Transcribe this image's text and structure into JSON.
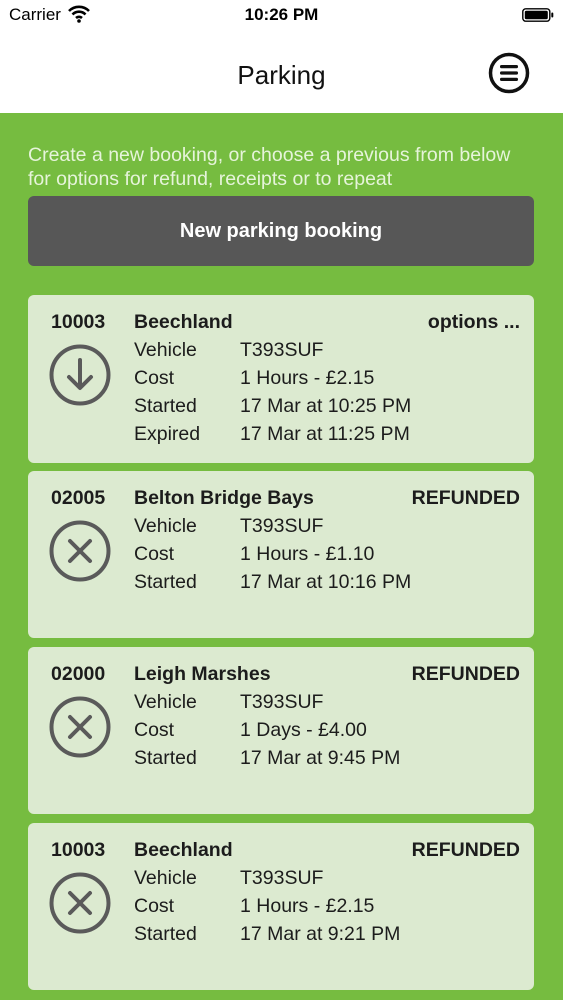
{
  "status_bar": {
    "carrier": "Carrier",
    "time": "10:26 PM"
  },
  "nav": {
    "title": "Parking",
    "menu_icon": "menu-icon"
  },
  "intro_text": "Create a new booking, or choose a previous from below for options for refund, receipts or to repeat",
  "new_booking_label": "New parking booking",
  "labels": {
    "vehicle": "Vehicle",
    "cost": "Cost",
    "started": "Started",
    "expired": "Expired"
  },
  "bookings": [
    {
      "code": "10003",
      "location": "Beechland",
      "status": "options ...",
      "icon": "download-icon",
      "vehicle": "T393SUF",
      "cost": "1 Hours - £2.15",
      "started": "17 Mar at 10:25 PM",
      "expired": "17 Mar at 11:25 PM"
    },
    {
      "code": "02005",
      "location": "Belton Bridge Bays",
      "status": "REFUNDED",
      "icon": "cancelled-icon",
      "vehicle": "T393SUF",
      "cost": "1 Hours - £1.10",
      "started": "17 Mar at 10:16 PM"
    },
    {
      "code": "02000",
      "location": "Leigh Marshes",
      "status": "REFUNDED",
      "icon": "cancelled-icon",
      "vehicle": "T393SUF",
      "cost": "1 Days - £4.00",
      "started": "17 Mar at 9:45 PM"
    },
    {
      "code": "10003",
      "location": "Beechland",
      "status": "REFUNDED",
      "icon": "cancelled-icon",
      "vehicle": "T393SUF",
      "cost": "1 Hours - £2.15",
      "started": "17 Mar at 9:21 PM"
    }
  ],
  "colors": {
    "background": "#76bc40",
    "card": "#dcead0",
    "button": "#575757"
  }
}
